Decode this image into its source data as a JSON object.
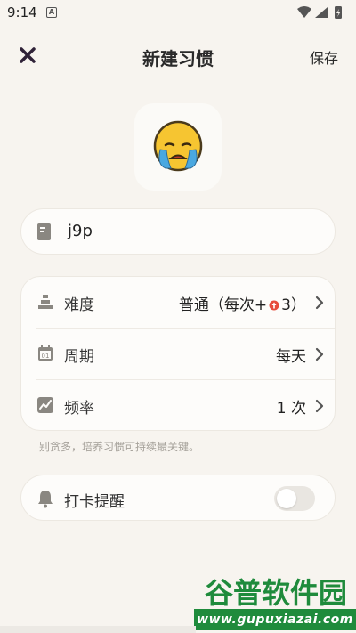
{
  "status_bar": {
    "time": "9:14",
    "notification_letter": "A"
  },
  "header": {
    "title": "新建习惯",
    "save_label": "保存",
    "close_icon": "close-icon"
  },
  "habit": {
    "emoji_icon": "crying-face-emoji",
    "name_value": "j9p"
  },
  "settings": {
    "difficulty": {
      "label": "难度",
      "value_prefix": "普通（每次+",
      "value_suffix": "3）",
      "icon": "difficulty-icon"
    },
    "period": {
      "label": "周期",
      "value": "每天",
      "icon": "calendar-icon"
    },
    "frequency": {
      "label": "频率",
      "value": "1 次",
      "icon": "frequency-icon"
    }
  },
  "tip": "别贪多，培养习惯可持续最关键。",
  "reminder": {
    "label": "打卡提醒",
    "enabled": false,
    "icon": "bell-icon"
  },
  "watermark": {
    "top_text": "谷普软件园",
    "bottom_text": "www.gupuxiazai.com"
  },
  "colors": {
    "background": "#f7f4ef",
    "card": "#fdfcfa",
    "icon_gray": "#8a8781",
    "coin_red": "#e74c3c",
    "watermark_green": "#1f8b3c"
  }
}
